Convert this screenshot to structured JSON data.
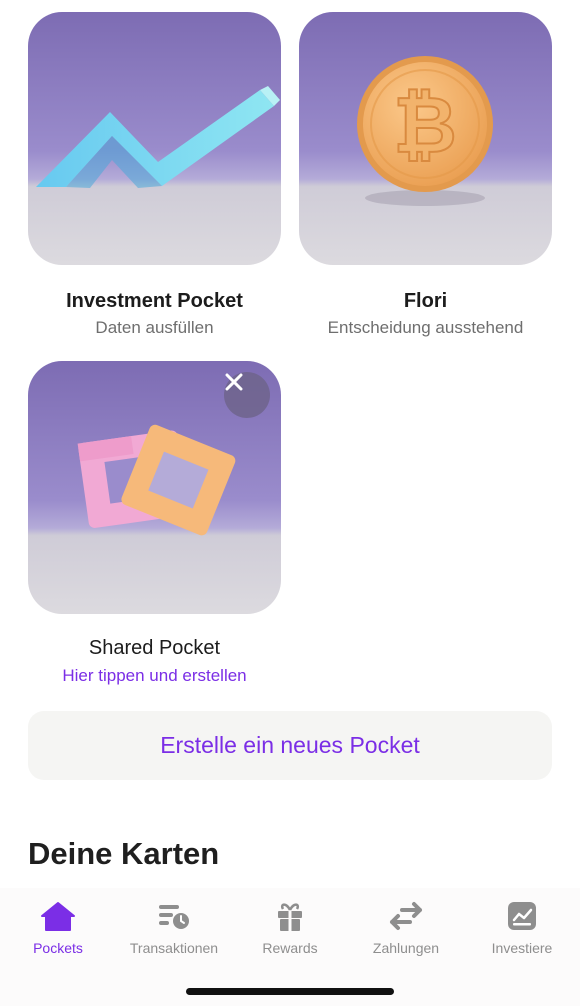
{
  "pockets": [
    {
      "title": "Investment Pocket",
      "subtitle": "Daten ausfüllen",
      "image_icon": "trend-chart-3d"
    },
    {
      "title": "Flori",
      "subtitle": "Entscheidung ausstehend",
      "image_icon": "bitcoin-coin-3d"
    },
    {
      "title": "Shared Pocket",
      "subtitle": "Hier tippen und erstellen",
      "image_icon": "linked-squares-3d"
    }
  ],
  "new_pocket_button": "Erstelle ein neues Pocket",
  "cards_section_title": "Deine Karten",
  "tabbar": {
    "items": [
      {
        "label": "Pockets",
        "icon": "home-icon",
        "active": true
      },
      {
        "label": "Transaktionen",
        "icon": "transactions-icon",
        "active": false
      },
      {
        "label": "Rewards",
        "icon": "gift-icon",
        "active": false
      },
      {
        "label": "Zahlungen",
        "icon": "transfer-icon",
        "active": false
      },
      {
        "label": "Investiere",
        "icon": "invest-icon",
        "active": false
      }
    ]
  },
  "colors": {
    "accent": "#7b2ee6",
    "inactive": "#8e8e8e",
    "button_bg": "#f5f5f3"
  }
}
